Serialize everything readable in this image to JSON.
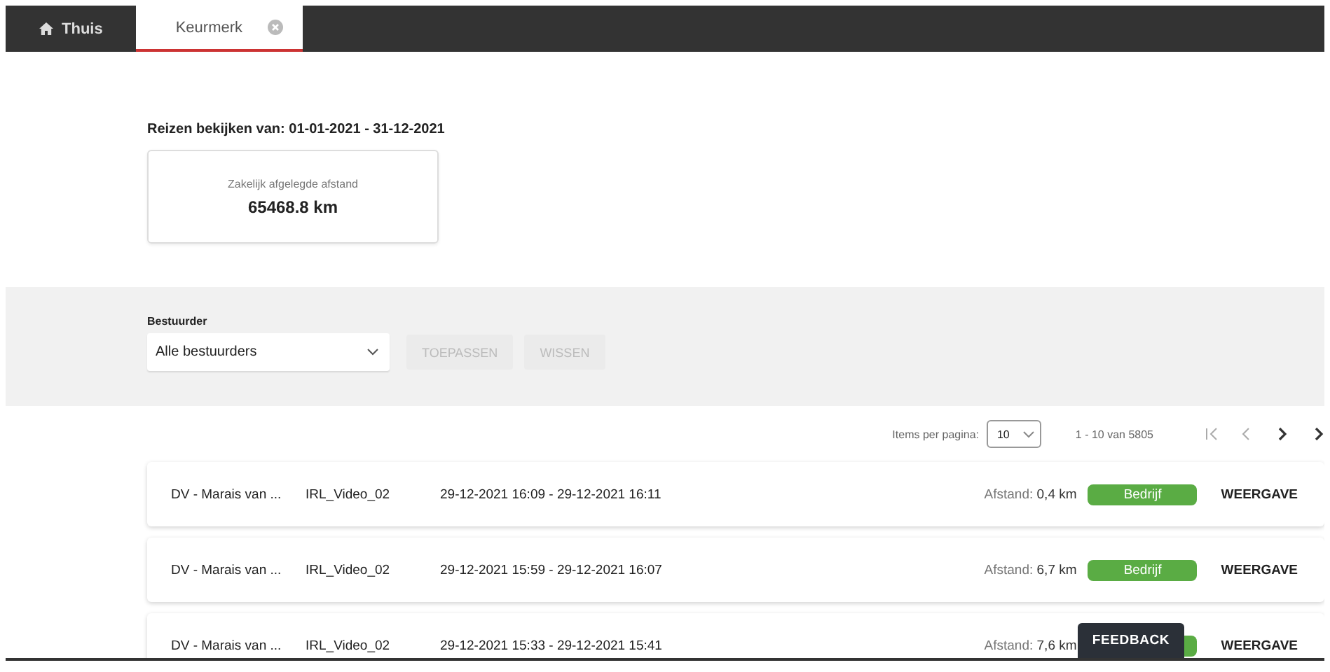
{
  "tabs": [
    {
      "label": "Thuis",
      "kind": "home",
      "selected": false,
      "closable": false
    },
    {
      "label": "Keurmerk",
      "selected": true,
      "closable": true
    }
  ],
  "period_heading": "Reizen bekijken van: 01-01-2021 - 31-12-2021",
  "summary": {
    "label": "Zakelijk afgelegde afstand",
    "value": "65468.8 km"
  },
  "filter": {
    "label": "Bestuurder",
    "select": "Alle bestuurders",
    "buttons": [
      {
        "label": "TOEPASSEN",
        "disabled": true
      },
      {
        "label": "WISSEN",
        "disabled": true
      }
    ]
  },
  "pagination": {
    "label": "Items per pagina:",
    "page_size": "10",
    "range": "1 - 10 van 5805",
    "buttons": [
      {
        "kind": "first",
        "disabled": true
      },
      {
        "kind": "prev",
        "disabled": true
      },
      {
        "kind": "next",
        "disabled": false
      },
      {
        "kind": "last",
        "disabled": false
      }
    ]
  },
  "trips": [
    {
      "driver": "DV - Marais van ...",
      "vehicle": "IRL_Video_02",
      "period": "29-12-2021 16:09 - 29-12-2021 16:11",
      "distance_label": "Afstand:",
      "distance": "0,4 km",
      "tag": "Bedrijf",
      "action": "WEERGAVE"
    },
    {
      "driver": "DV - Marais van ...",
      "vehicle": "IRL_Video_02",
      "period": "29-12-2021 15:59 - 29-12-2021 16:07",
      "distance_label": "Afstand:",
      "distance": "6,7 km",
      "tag": "Bedrijf",
      "action": "WEERGAVE"
    },
    {
      "driver": "DV - Marais van ...",
      "vehicle": "IRL_Video_02",
      "period": "29-12-2021 15:33 - 29-12-2021 15:41",
      "distance_label": "Afstand:",
      "distance": "7,6 km",
      "has_tag": true,
      "action": "WEERGAVE"
    }
  ],
  "feedback": {
    "label": "FEEDBACK"
  }
}
